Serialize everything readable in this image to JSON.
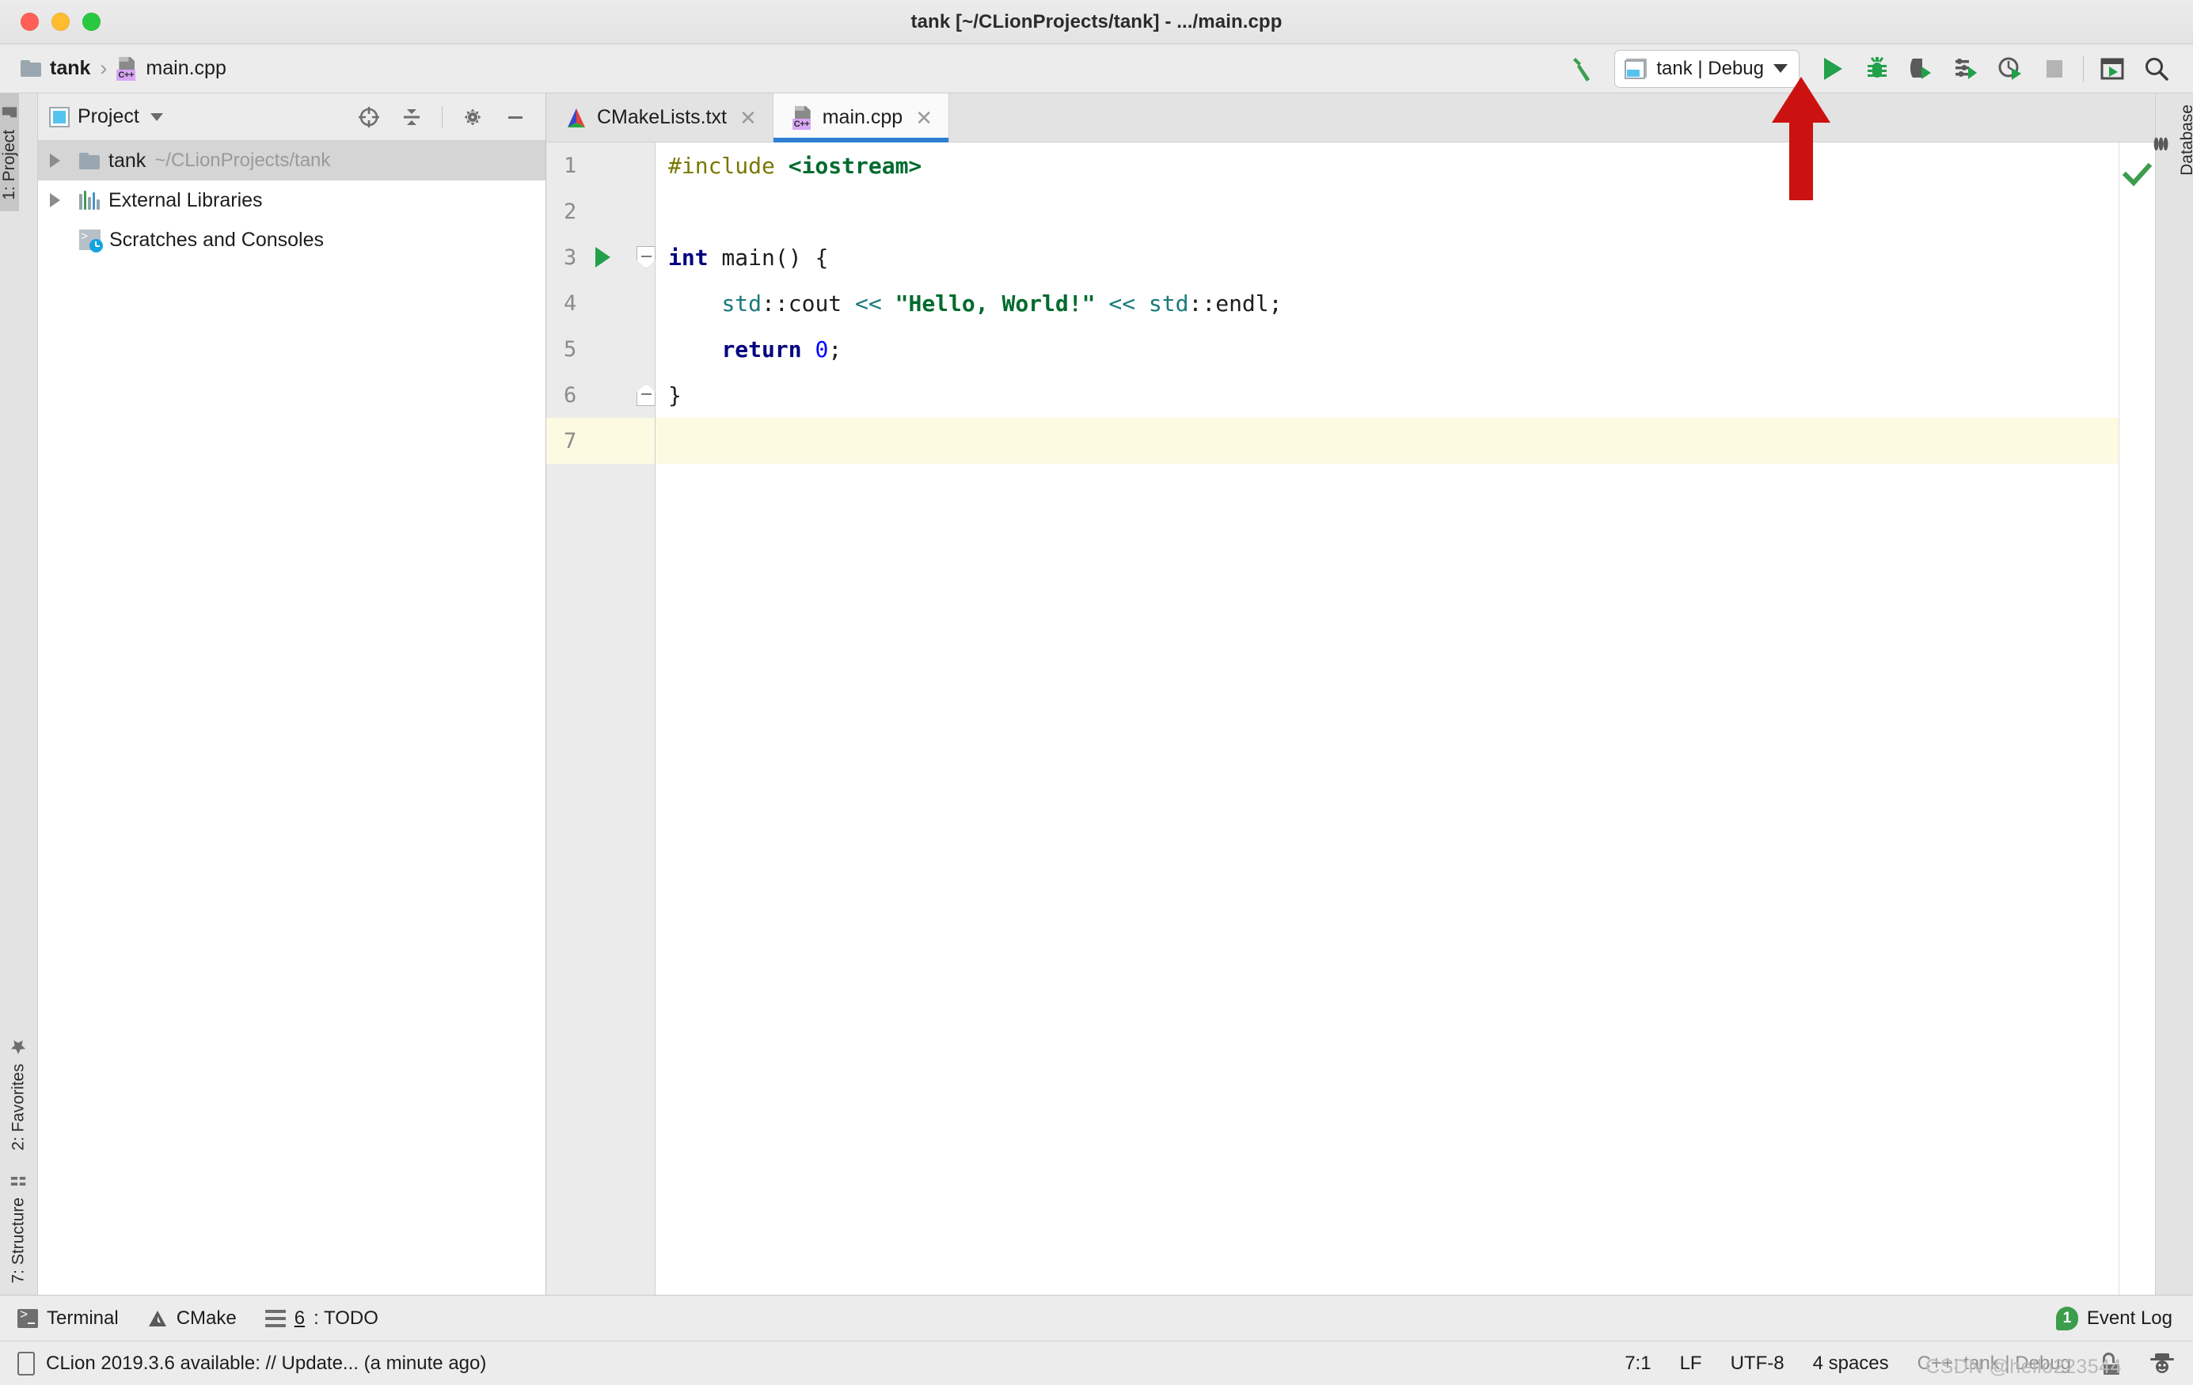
{
  "window": {
    "title": "tank [~/CLionProjects/tank] - .../main.cpp",
    "controls": {
      "close": "close-button",
      "minimize": "minimize-button",
      "zoom": "zoom-button"
    }
  },
  "breadcrumb": {
    "items": [
      {
        "label": "tank",
        "icon": "folder-icon"
      },
      {
        "label": "main.cpp",
        "icon": "cpp-file-icon"
      }
    ],
    "separator": "›"
  },
  "toolbar": {
    "build_label": "Build",
    "run_config": {
      "label": "tank | Debug",
      "icon": "run-config-icon"
    },
    "buttons": [
      {
        "name": "run-button",
        "title": "Run"
      },
      {
        "name": "debug-button",
        "title": "Debug"
      },
      {
        "name": "run-with-coverage-button",
        "title": "Run with Coverage"
      },
      {
        "name": "profile-button",
        "title": "Profile"
      },
      {
        "name": "run-with-valgrind-button",
        "title": "Run with Valgrind Memcheck"
      },
      {
        "name": "stop-button",
        "title": "Stop"
      },
      {
        "name": "select-target-button",
        "title": "Select Run/Debug Configuration"
      },
      {
        "name": "search-everywhere-button",
        "title": "Search Everywhere"
      }
    ]
  },
  "left_strip": {
    "top": [
      {
        "label": "1: Project",
        "icon": "project-folder-icon",
        "active": true
      }
    ],
    "bottom": [
      {
        "label": "2: Favorites",
        "icon": "star-icon",
        "active": false
      },
      {
        "label": "7: Structure",
        "icon": "structure-icon",
        "active": false
      }
    ]
  },
  "right_strip": {
    "items": [
      {
        "label": "Database",
        "icon": "database-icon",
        "active": false
      }
    ]
  },
  "project_panel": {
    "title": "Project",
    "dropdown_icon": "chevron-down-icon",
    "actions": [
      {
        "name": "select-opened-file-icon",
        "title": "Select Opened File"
      },
      {
        "name": "collapse-all-icon",
        "title": "Collapse All"
      },
      {
        "name": "settings-gear-icon",
        "title": "Settings"
      },
      {
        "name": "hide-panel-icon",
        "title": "Hide"
      }
    ],
    "tree": [
      {
        "label": "tank",
        "detail": "~/CLionProjects/tank",
        "icon": "folder-icon",
        "expandable": true,
        "selected": true,
        "indent": 0
      },
      {
        "label": "External Libraries",
        "detail": "",
        "icon": "libraries-icon",
        "expandable": true,
        "selected": false,
        "indent": 0
      },
      {
        "label": "Scratches and Consoles",
        "detail": "",
        "icon": "scratches-icon",
        "expandable": false,
        "selected": false,
        "indent": 0
      }
    ]
  },
  "editor": {
    "tabs": [
      {
        "label": "CMakeLists.txt",
        "icon": "cmake-file-icon",
        "active": false,
        "close": "✕"
      },
      {
        "label": "main.cpp",
        "icon": "cpp-file-icon",
        "active": true,
        "close": "✕"
      }
    ],
    "line_numbers": [
      "1",
      "2",
      "3",
      "4",
      "5",
      "6",
      "7"
    ],
    "current_line": 7,
    "run_marker_line": 3,
    "inspection_status": "ok-check-icon",
    "lines": [
      {
        "n": 1,
        "tokens": [
          {
            "t": "#include ",
            "c": "k-pre"
          },
          {
            "t": "<iostream>",
            "c": "k-inc"
          }
        ]
      },
      {
        "n": 2,
        "tokens": []
      },
      {
        "n": 3,
        "tokens": [
          {
            "t": "int",
            "c": "k-kw"
          },
          {
            "t": " main() {",
            "c": "k-plain"
          }
        ]
      },
      {
        "n": 4,
        "tokens": [
          {
            "t": "    ",
            "c": "k-plain"
          },
          {
            "t": "std",
            "c": "k-ns"
          },
          {
            "t": "::cout ",
            "c": "k-plain"
          },
          {
            "t": "<<",
            "c": "k-op"
          },
          {
            "t": " ",
            "c": "k-plain"
          },
          {
            "t": "\"Hello, World!\"",
            "c": "k-str"
          },
          {
            "t": " ",
            "c": "k-plain"
          },
          {
            "t": "<<",
            "c": "k-op"
          },
          {
            "t": " ",
            "c": "k-plain"
          },
          {
            "t": "std",
            "c": "k-ns"
          },
          {
            "t": "::endl;",
            "c": "k-plain"
          }
        ]
      },
      {
        "n": 5,
        "tokens": [
          {
            "t": "    ",
            "c": "k-plain"
          },
          {
            "t": "return",
            "c": "k-kw"
          },
          {
            "t": " ",
            "c": "k-plain"
          },
          {
            "t": "0",
            "c": "k-num"
          },
          {
            "t": ";",
            "c": "k-plain"
          }
        ]
      },
      {
        "n": 6,
        "tokens": [
          {
            "t": "}",
            "c": "k-plain"
          }
        ]
      },
      {
        "n": 7,
        "tokens": []
      }
    ]
  },
  "bottom_tools": {
    "items": [
      {
        "label": "Terminal",
        "icon": "terminal-icon",
        "num": ""
      },
      {
        "label": "CMake",
        "icon": "cmake-icon",
        "num": ""
      },
      {
        "label": ": TODO",
        "icon": "todo-icon",
        "num": "6"
      }
    ],
    "event_log": {
      "label": "Event Log",
      "count": "1"
    }
  },
  "statusbar": {
    "message": "CLion 2019.3.6 available: // Update... (a minute ago)",
    "message_icon": "ide-update-icon",
    "caret_position": "7:1",
    "line_separator": "LF",
    "encoding": "UTF-8",
    "indent": "4 spaces",
    "configuration": "C++: tank | Debug",
    "lock_icon": "unlocked-icon",
    "inspector_icon": "hector-inspector-icon"
  },
  "annotation": {
    "arrow": "red-arrow-pointing-to-run-button",
    "color": "#cc1111"
  },
  "watermark": {
    "text": "CSDN @hello223544"
  },
  "colors": {
    "accent_blue": "#2d7fd3",
    "run_green": "#22a04a",
    "panel_bg": "#ececec",
    "editor_bg": "#ffffff",
    "current_line": "#fdfae2",
    "selection": "#d5d5d5"
  }
}
